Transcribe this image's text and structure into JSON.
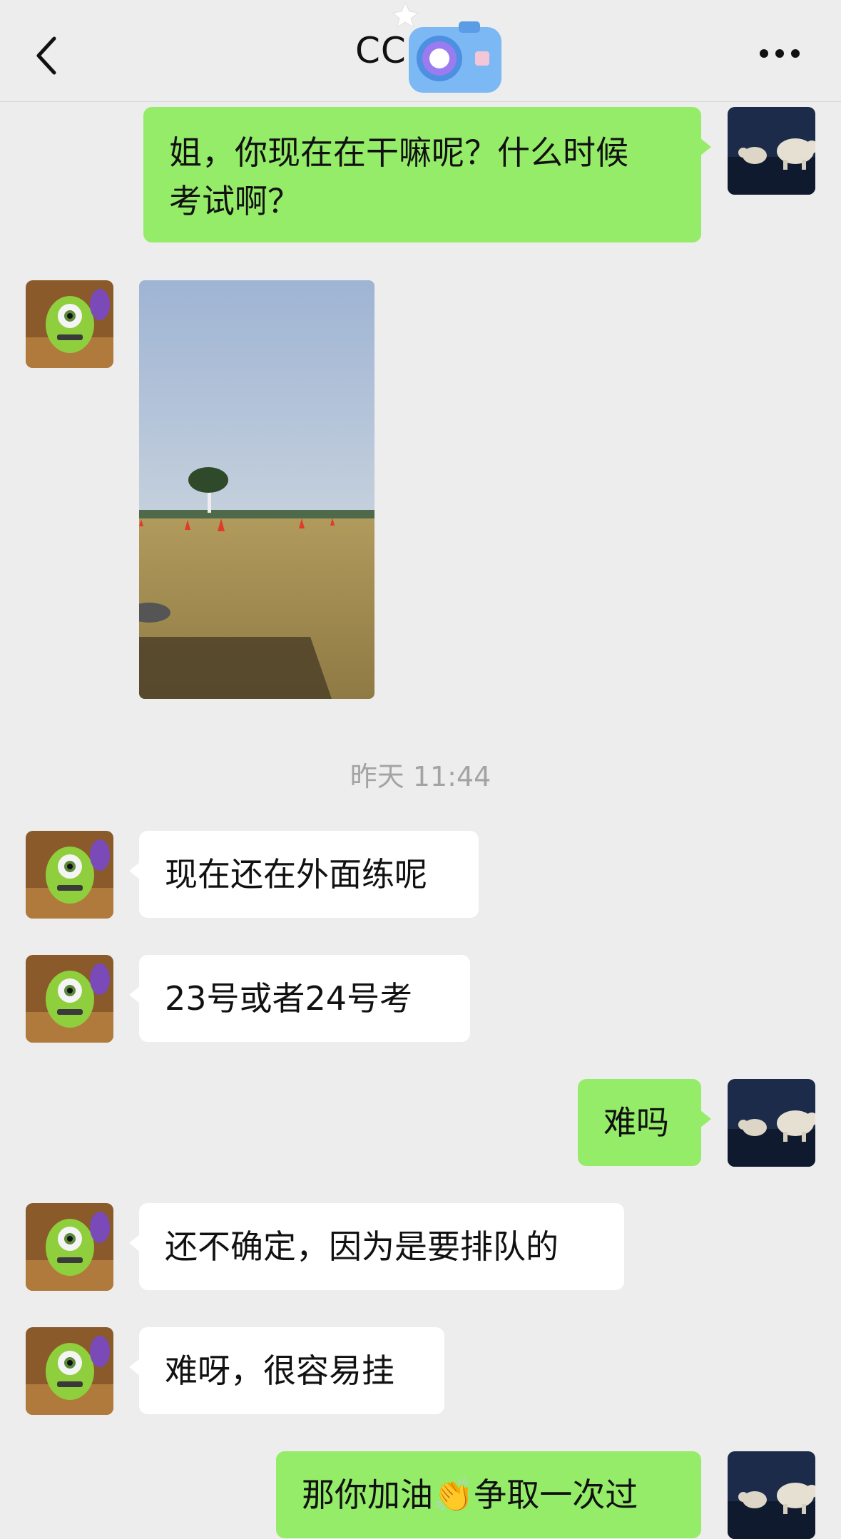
{
  "header": {
    "title": "CC",
    "back_icon": "chevron-left-icon",
    "more_icon": "more-dots-icon"
  },
  "colors": {
    "background": "#ededed",
    "my_bubble": "#95ec69",
    "their_bubble": "#ffffff",
    "timestamp_text": "#a3a3a3"
  },
  "messages": [
    {
      "sender": "me",
      "type": "text",
      "text": "姐，你现在在干嘛呢？什么时候\n考试啊？"
    },
    {
      "sender": "them",
      "type": "image",
      "image": "photo-of-driving-test-field"
    },
    {
      "sender": "system",
      "type": "timestamp",
      "text": "昨天 11:44"
    },
    {
      "sender": "them",
      "type": "text",
      "text": "现在还在外面练呢"
    },
    {
      "sender": "them",
      "type": "text",
      "text": "23号或者24号考"
    },
    {
      "sender": "me",
      "type": "text",
      "text": "难吗"
    },
    {
      "sender": "them",
      "type": "text",
      "text": "还不确定，因为是要排队的"
    },
    {
      "sender": "them",
      "type": "text",
      "text": "难呀，很容易挂"
    },
    {
      "sender": "me",
      "type": "text",
      "text": "那你加油👏争取一次过"
    }
  ]
}
